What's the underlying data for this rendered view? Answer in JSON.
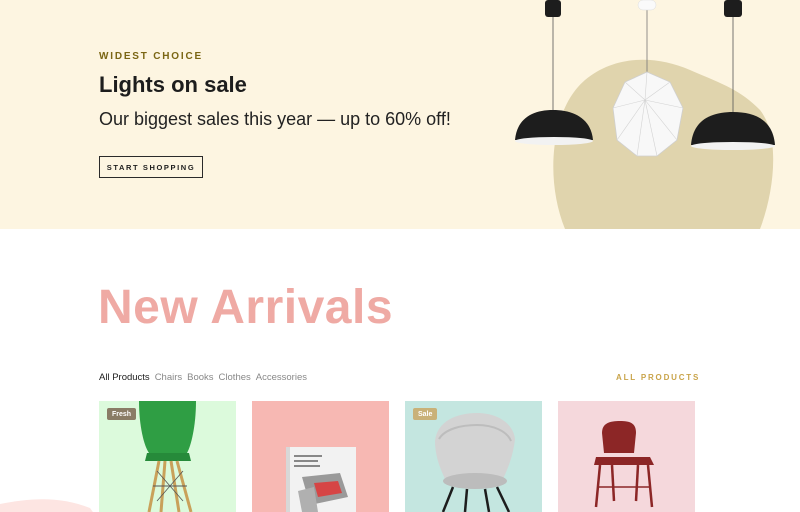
{
  "hero": {
    "kicker": "WIDEST CHOICE",
    "title": "Lights on sale",
    "subtitle": "Our biggest sales this year — up to 60% off!",
    "button_label": "START SHOPPING",
    "background": "#fdf5e1"
  },
  "arrivals": {
    "title": "New Arrivals",
    "title_color": "#efaaa4",
    "filters": [
      {
        "label": "All Products",
        "active": true
      },
      {
        "label": "Chairs",
        "active": false
      },
      {
        "label": "Books",
        "active": false
      },
      {
        "label": "Clothes",
        "active": false
      },
      {
        "label": "Accessories",
        "active": false
      }
    ],
    "all_products_label": "ALL PRODUCTS"
  },
  "products": [
    {
      "badge": "Fresh",
      "bg": "#dcfadc",
      "icon": "green-chair-icon"
    },
    {
      "badge": "",
      "bg": "#f7b8b3",
      "icon": "book-icon"
    },
    {
      "badge": "Sale",
      "bg": "#c4e6e0",
      "icon": "gray-armchair-icon"
    },
    {
      "badge": "",
      "bg": "#f5d8dc",
      "icon": "red-chair-icon"
    }
  ]
}
